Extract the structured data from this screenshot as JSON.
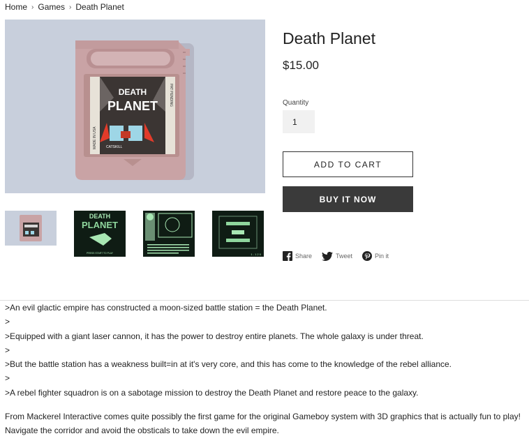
{
  "breadcrumb": {
    "items": [
      "Home",
      "Games",
      "Death Planet"
    ]
  },
  "product": {
    "title": "Death Planet",
    "price": "$15.00",
    "quantity_label": "Quantity",
    "quantity_value": "1",
    "add_to_cart": "ADD TO CART",
    "buy_now": "BUY IT NOW"
  },
  "cartridge": {
    "label_title_1": "DEATH",
    "label_title_2": "PLANET",
    "side_left": "MADE IN USA",
    "side_left_top": "CIRCUIT-MSTR",
    "side_right": "PAT PENDING",
    "publisher": "CATSKILL"
  },
  "thumbnails": {
    "t2_title_1": "DEATH",
    "t2_title_2": "PLANET",
    "t2_press": "PRESS START TO PLAY",
    "t3_counter": "1 - 1 2 0"
  },
  "social": {
    "share": "Share",
    "tweet": "Tweet",
    "pin": "Pin it"
  },
  "description": {
    "lines": [
      ">An evil glactic empire has constructed a moon-sized battle station = the Death Planet.",
      ">",
      ">Equipped with a giant laser cannon, it has the power to destroy entire planets. The whole galaxy is under threat.",
      ">",
      ">But the battle station has a weakness built=in at it's very core, and this has come to the knowledge of the rebel alliance.",
      ">",
      ">A rebel fighter squadron is on a sabotage mission to destroy the Death Planet and restore peace to the galaxy."
    ],
    "paragraph": "From Mackerel Interactive comes quite possibly the first game for the original Gameboy system with 3D graphics that is actually fun to play! Navigate the corridor and avoid the obsticals to take down the evil empire."
  },
  "colors": {
    "button_dark": "#3a3a3a",
    "cartridge": "#c9a3a5",
    "hero_bg": "#c8cfdc"
  }
}
